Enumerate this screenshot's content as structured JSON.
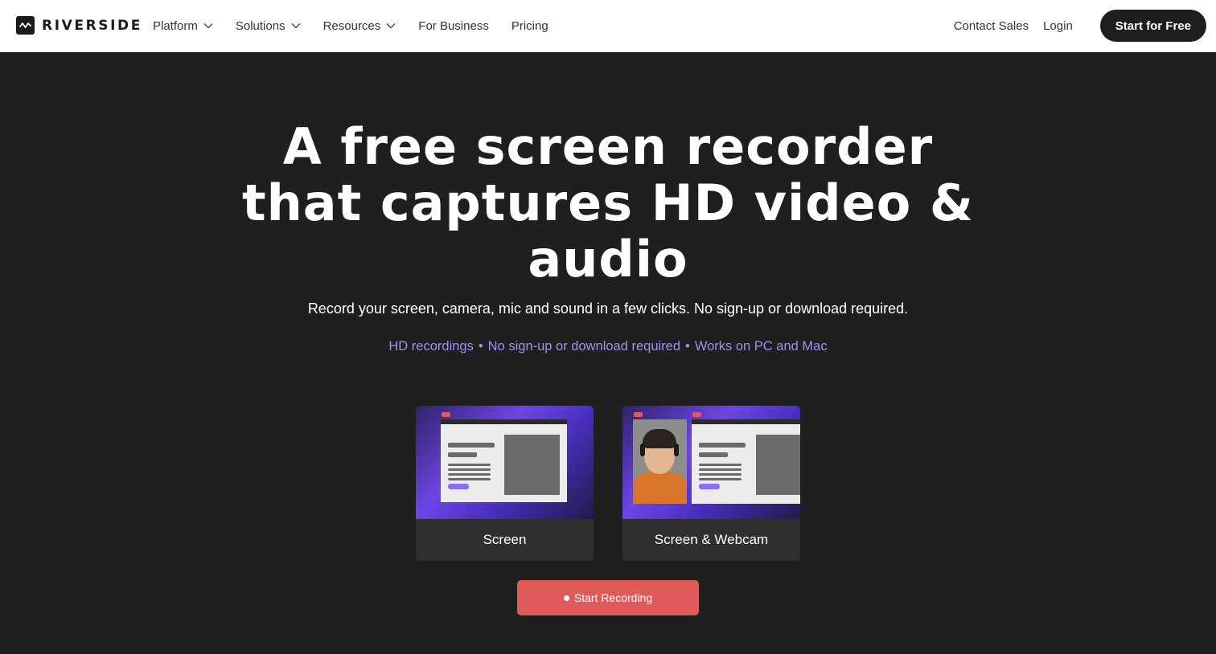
{
  "nav": {
    "logo_text": "RIVERSIDE",
    "links": [
      {
        "label": "Platform",
        "has_dropdown": true
      },
      {
        "label": "Solutions",
        "has_dropdown": true
      },
      {
        "label": "Resources",
        "has_dropdown": true
      },
      {
        "label": "For Business",
        "has_dropdown": false
      },
      {
        "label": "Pricing",
        "has_dropdown": false
      }
    ],
    "contact_sales": "Contact Sales",
    "login": "Login",
    "cta": "Start for Free"
  },
  "hero": {
    "title_line1": "A free screen recorder",
    "title_line2": "that captures HD video &",
    "title_line3": "audio",
    "subtitle": "Record your screen, camera, mic and sound in a few clicks. No sign-up or download required.",
    "features": [
      "HD recordings",
      "No sign-up or download required",
      "Works on PC and Mac"
    ],
    "feature_separator": "•"
  },
  "options": [
    {
      "label": "Screen",
      "thumbnail": "screen-preview"
    },
    {
      "label": "Screen & Webcam",
      "thumbnail": "screen-webcam-preview"
    }
  ],
  "record_button": "Start Recording",
  "colors": {
    "page_bg": "#1f1f1f",
    "nav_bg": "#ffffff",
    "accent_purple": "#a08ff0",
    "record_red": "#e05a5a",
    "card_bg": "#2f2f2f"
  },
  "icons": [
    "riverside-logo-icon",
    "chevron-down-icon",
    "record-dot-icon"
  ]
}
